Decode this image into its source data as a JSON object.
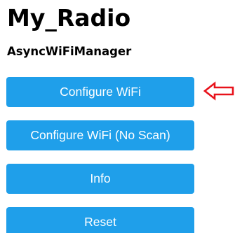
{
  "page": {
    "title": "My_Radio",
    "subtitle": "AsyncWiFiManager"
  },
  "menu": {
    "buttons": [
      {
        "label": "Configure WiFi"
      },
      {
        "label": "Configure WiFi (No Scan)"
      },
      {
        "label": "Info"
      },
      {
        "label": "Reset"
      }
    ]
  },
  "annotation": {
    "icon": "left-arrow-icon",
    "color": "#e8121b"
  },
  "colors": {
    "button_background": "#1f9fea",
    "button_text": "#ffffff"
  }
}
